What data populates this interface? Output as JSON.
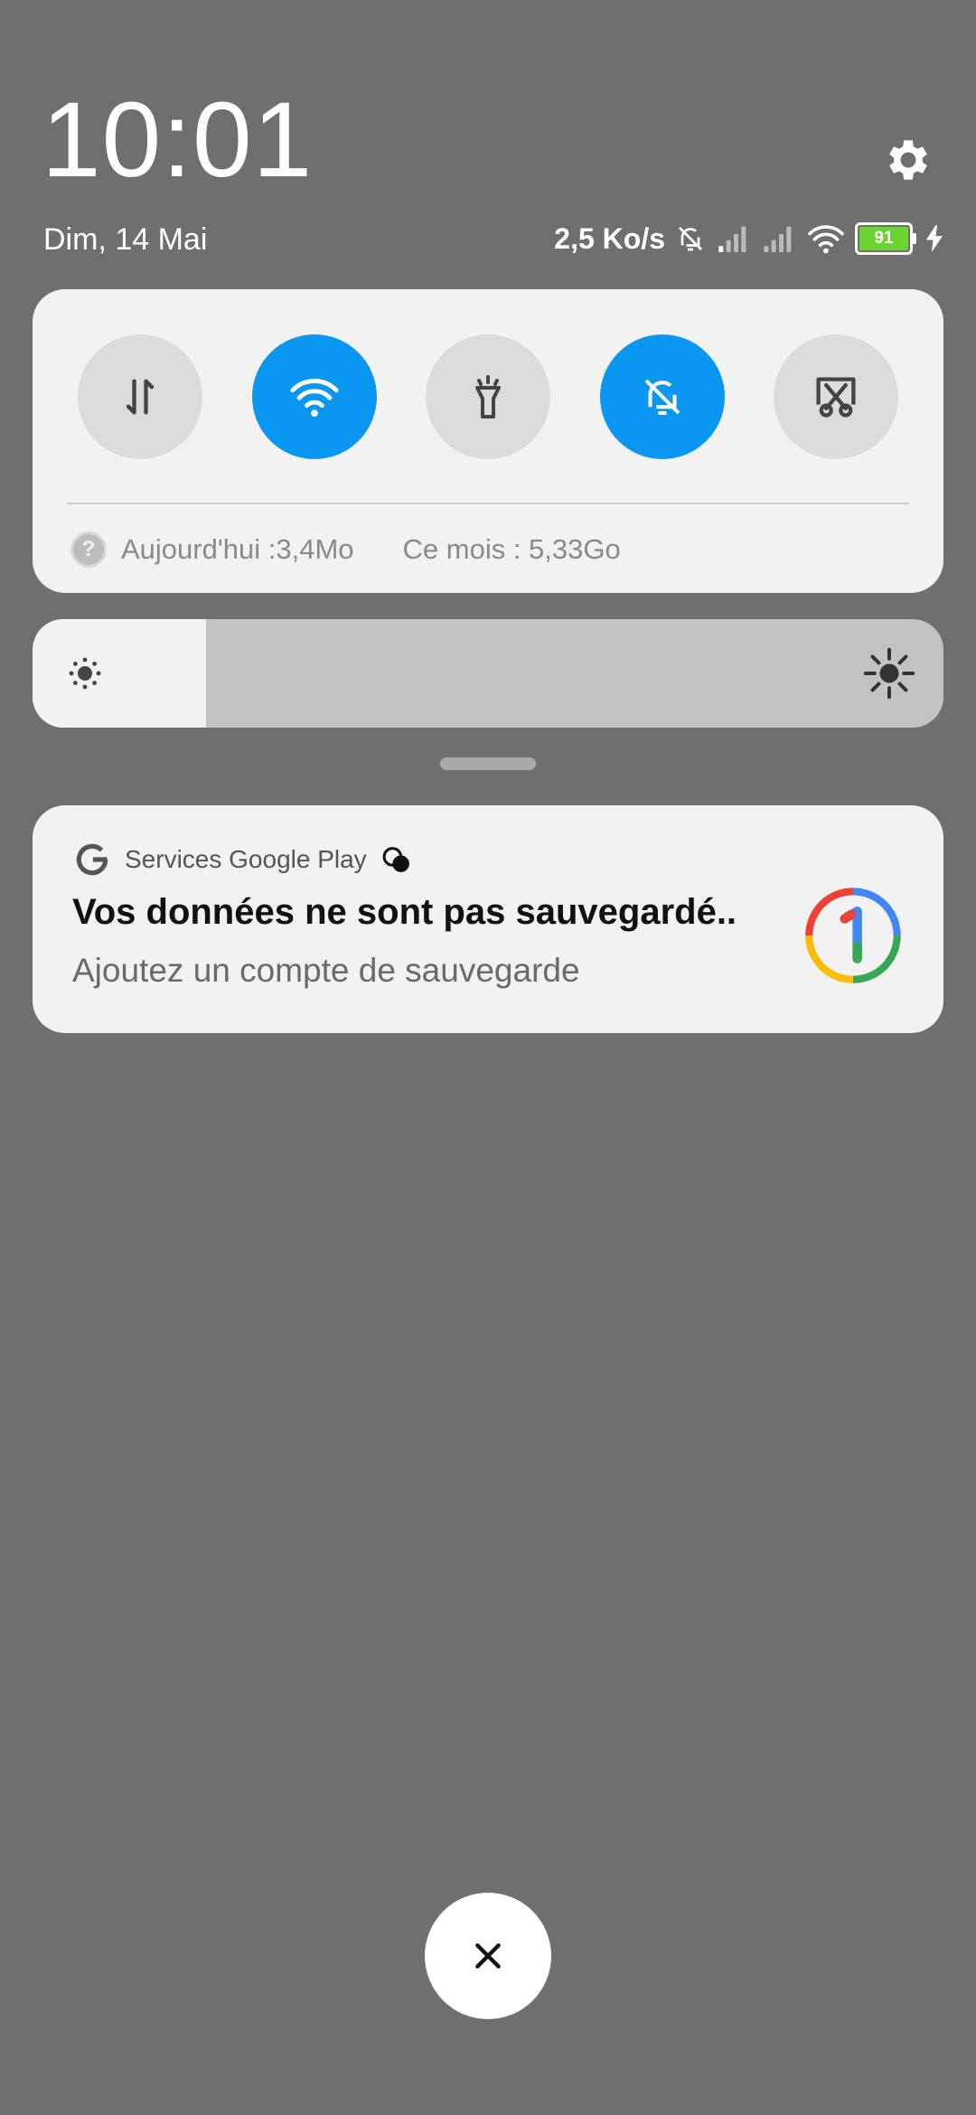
{
  "header": {
    "time": "10:01",
    "date": "Dim, 14 Mai"
  },
  "status_bar": {
    "net_speed": "2,5 Ko/s",
    "battery_level": "91",
    "icons": [
      "dnd-icon",
      "signal-icon",
      "signal-icon",
      "wifi-icon",
      "battery-icon",
      "charging-icon"
    ]
  },
  "quick_settings": {
    "toggles": [
      {
        "name": "mobile-data-icon",
        "on": false
      },
      {
        "name": "wifi-icon",
        "on": true
      },
      {
        "name": "flashlight-icon",
        "on": false
      },
      {
        "name": "dnd-icon",
        "on": true
      },
      {
        "name": "screenshot-icon",
        "on": false
      }
    ],
    "usage_today": "Aujourd'hui :3,4Mo",
    "usage_month": "Ce mois : 5,33Go",
    "help_glyph": "?"
  },
  "brightness": {
    "level": 0.19
  },
  "notification": {
    "app_name": "Services Google Play",
    "title": "Vos données ne sont pas sauvegardé..",
    "body": "Ajoutez un compte de sauvegarde",
    "app_icon": "google-one-icon"
  },
  "colors": {
    "background": "#6f6f6f",
    "accent": "#0997f1",
    "card": "#f2f2f2",
    "battery_fill": "#6bd32f"
  }
}
